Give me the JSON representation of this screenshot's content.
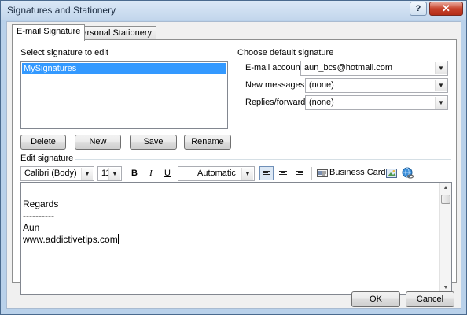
{
  "window": {
    "title": "Signatures and Stationery",
    "help": "?",
    "close": "✕"
  },
  "tabs": [
    {
      "label": "E-mail Signature",
      "active": true
    },
    {
      "label": "Personal Stationery",
      "active": false
    }
  ],
  "select_signature": {
    "label": "Select signature to edit",
    "items": [
      "MySignatures"
    ],
    "selected": "MySignatures"
  },
  "buttons": {
    "delete": "Delete",
    "new": "New",
    "save": "Save",
    "rename": "Rename",
    "ok": "OK",
    "cancel": "Cancel"
  },
  "default_signature": {
    "heading": "Choose default signature",
    "email_account_label": "E-mail account:",
    "email_account_value": "aun_bcs@hotmail.com",
    "new_messages_label": "New messages:",
    "new_messages_value": "(none)",
    "replies_label": "Replies/forwards:",
    "replies_value": "(none)"
  },
  "edit_signature": {
    "label": "Edit signature",
    "font": "Calibri (Body)",
    "size": "11",
    "bold": "B",
    "italic": "I",
    "underline": "U",
    "color": "Automatic",
    "business_card": "Business Card",
    "alignment": "left",
    "text_lines": [
      "Regards",
      "----------",
      "Aun",
      "www.addictivetips.com"
    ]
  },
  "colors": {
    "title_bar": "#c3d6ec",
    "selection": "#3399ff",
    "close_button": "#c7432c"
  },
  "icons": {
    "business_card": "business-card-icon",
    "insert_picture": "insert-picture-icon",
    "hyperlink": "hyperlink-icon"
  }
}
